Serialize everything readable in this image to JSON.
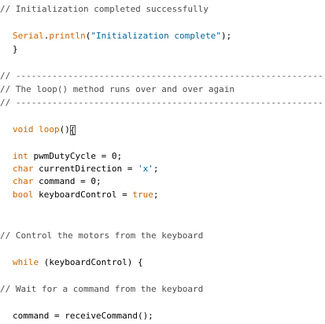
{
  "code": {
    "l1_comment": "// Initialization completed successfully",
    "l2_obj": "Serial",
    "l2_dot": ".",
    "l2_fn": "println",
    "l2_open": "(",
    "l2_str": "\"Initialization complete\"",
    "l2_close": ");",
    "l3_brace": "}",
    "l4_comment": "// -----------------------------------------------------------",
    "l5_comment": "// The loop() method runs over and over again",
    "l6_comment": "// -----------------------------------------------------------",
    "l7_kw": "void",
    "l7_sp": " ",
    "l7_fn": "loop",
    "l7_paren": "()",
    "l7_brace": "{",
    "l8_type": "int",
    "l8_rest": " pwmDutyCycle = 0;",
    "l9_type": "char",
    "l9_rest": " currentDirection = ",
    "l9_str": "'x'",
    "l9_end": ";",
    "l10_type": "char",
    "l10_rest": " command = 0;",
    "l11_type": "bool",
    "l11_rest": " keyboardControl = ",
    "l11_lit": "true",
    "l11_end": ";",
    "l12_comment": "// Control the motors from the keyboard",
    "l13_kw": "while",
    "l13_rest": " (keyboardControl) {",
    "l14_comment": "// Wait for a command from the keyboard",
    "l15_text": "command = receiveCommand();"
  },
  "colors": {
    "comment": "#4d4d4d",
    "keyword": "#cc6600",
    "string": "#006699",
    "text": "#000000",
    "background": "#ffffff"
  }
}
